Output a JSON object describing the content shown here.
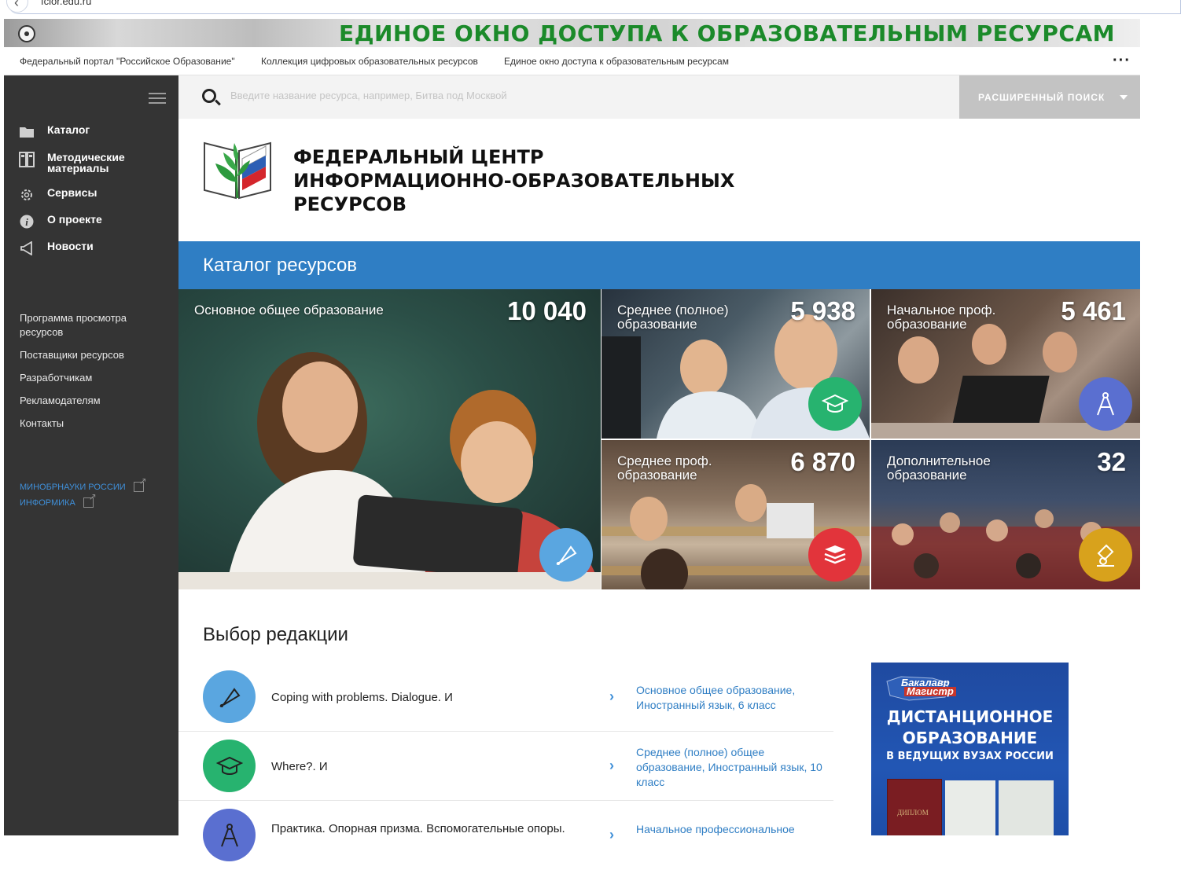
{
  "browser": {
    "url": "fcior.edu.ru"
  },
  "banner": {
    "title": "ЕДИНОЕ ОКНО ДОСТУПА К ОБРАЗОВАТЕЛЬНЫМ РЕСУРСАМ"
  },
  "top_links": [
    "Федеральный портал \"Российское Образование\"",
    "Коллекция цифровых образовательных ресурсов",
    "Единое окно доступа к образовательным ресурсам"
  ],
  "top_more": "···",
  "sidebar": {
    "nav": [
      {
        "label": "Каталог",
        "icon": "folder-icon"
      },
      {
        "label": "Методические материалы",
        "icon": "book-icon"
      },
      {
        "label": "Сервисы",
        "icon": "gear-icon"
      },
      {
        "label": "О проекте",
        "icon": "info-icon"
      },
      {
        "label": "Новости",
        "icon": "megaphone-icon"
      }
    ],
    "links": [
      "Программа просмотра ресурсов",
      "Поставщики ресурсов",
      "Разработчикам",
      "Рекламодателям",
      "Контакты"
    ],
    "external": [
      "МИНОБРНАУКИ РОССИИ",
      "ИНФОРМИКА"
    ]
  },
  "search": {
    "placeholder": "Введите название ресурса, например, Битва под Москвой",
    "advanced_label": "РАСШИРЕННЫЙ ПОИСК"
  },
  "org": {
    "title": "ФЕДЕРАЛЬНЫЙ ЦЕНТР ИНФОРМАЦИОННО-ОБРАЗОВАТЕЛЬНЫХ РЕСУРСОВ"
  },
  "catalog": {
    "title": "Каталог ресурсов",
    "tiles": [
      {
        "label": "Основное общее образование",
        "count": "10 040",
        "icon": "bell-icon",
        "color": "#5aa6e0"
      },
      {
        "label": "Среднее (полное) образование",
        "count": "5 938",
        "icon": "graduation-cap-icon",
        "color": "#27b36f"
      },
      {
        "label": "Начальное проф. образование",
        "count": "5 461",
        "icon": "compass-icon",
        "color": "#5a6fd0"
      },
      {
        "label": "Среднее проф. образование",
        "count": "6 870",
        "icon": "books-stack-icon",
        "color": "#e2343b"
      },
      {
        "label": "Дополнительное образование",
        "count": "32",
        "icon": "microscope-icon",
        "color": "#d8a21c"
      }
    ]
  },
  "editor": {
    "title": "Выбор редакции",
    "rows": [
      {
        "title": "Coping with problems. Dialogue. И",
        "category": "Основное общее образование, Иностранный язык, 6 класс",
        "icon": "bell-icon",
        "color": "#5aa6e0"
      },
      {
        "title": "Where?. И",
        "category": "Среднее (полное) общее образование, Иностранный язык, 10 класс",
        "icon": "graduation-cap-icon",
        "color": "#27b36f"
      },
      {
        "title": "Практика. Опорная призма. Вспомогательные опоры.",
        "category": "Начальное профессиональное",
        "icon": "compass-icon",
        "color": "#5a6fd0"
      }
    ]
  },
  "ad": {
    "brand_top": "Бакалавр",
    "brand_bottom": "Магистр",
    "headline": "ДИСТАНЦИОННОЕ ОБРАЗОВАНИЕ",
    "subline": "В ВЕДУЩИХ ВУЗАХ РОССИИ",
    "diploma": "ДИПЛОМ"
  }
}
